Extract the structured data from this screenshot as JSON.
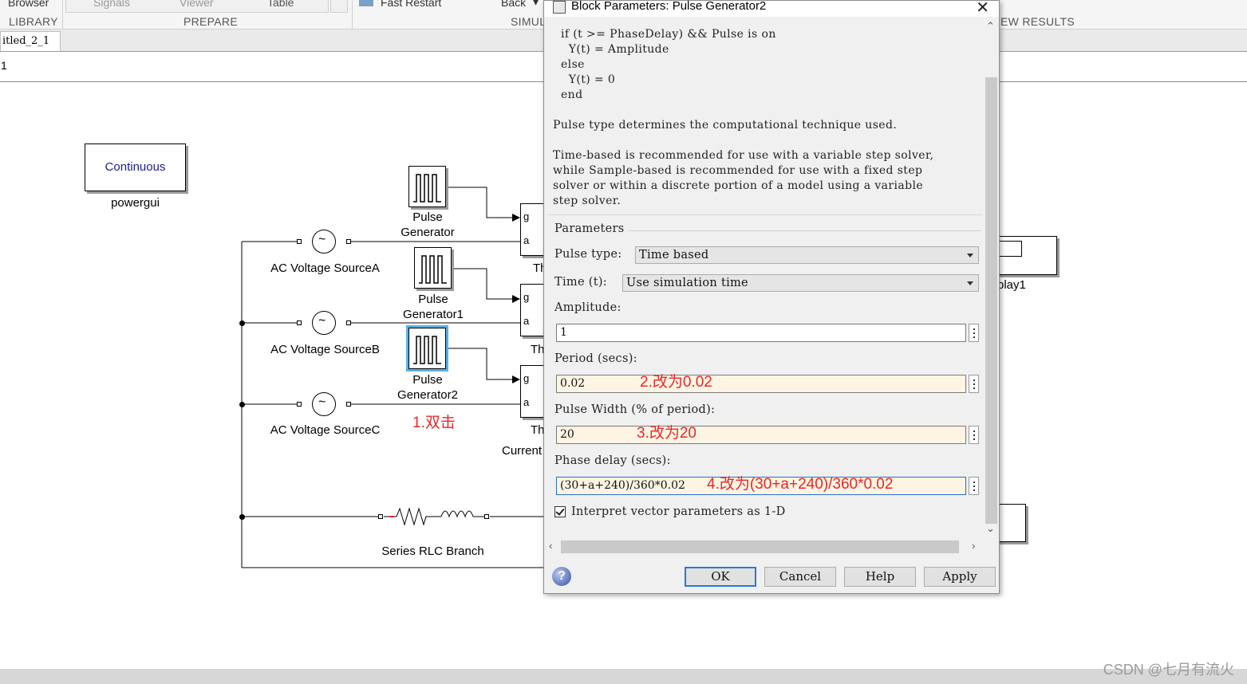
{
  "toolstrip": {
    "items": [
      "Browser",
      "Signals",
      "Viewer",
      "Table",
      "Fast Restart",
      "Back"
    ],
    "sections": [
      "LIBRARY",
      "PREPARE",
      "SIMUL",
      "EW RESULTS"
    ]
  },
  "tabs": {
    "model": "itled_2_1"
  },
  "address": {
    "path": "1"
  },
  "diagram": {
    "powergui": {
      "block_text": "Continuous",
      "label": "powergui"
    },
    "pulse_generators": [
      {
        "label_line1": "Pulse",
        "label_line2": "Generator"
      },
      {
        "label_line1": "Pulse",
        "label_line2": "Generator1"
      },
      {
        "label_line1": "Pulse",
        "label_line2": "Generator2"
      }
    ],
    "ac_sources": [
      "AC Voltage SourceA",
      "AC Voltage SourceB",
      "AC Voltage SourceC"
    ],
    "thyristor": {
      "port_g": "g",
      "port_a": "a",
      "label_prefix": "Th"
    },
    "current_label": "Current",
    "rlc_label": "Series RLC Branch",
    "display_label": "play1",
    "annotation_double_click": "1.双击"
  },
  "dialog": {
    "title": "Block Parameters: Pulse Generator2",
    "description_lines": [
      "if (t >= PhaseDelay) && Pulse is on",
      "  Y(t) = Amplitude",
      "else",
      "  Y(t) = 0",
      "end",
      "Pulse type determines the computational technique used.",
      "Time-based is recommended for use with a variable step solver,",
      "while Sample-based is recommended for use with a fixed step",
      "solver or within a discrete portion of a model using a variable",
      "step solver."
    ],
    "parameters_heading": "Parameters",
    "pulse_type": {
      "label": "Pulse type:",
      "value": "Time based"
    },
    "time": {
      "label": "Time (t):",
      "value": "Use simulation time"
    },
    "amplitude": {
      "label": "Amplitude:",
      "value": "1"
    },
    "period": {
      "label": "Period (secs):",
      "value": "0.02",
      "note": "2.改为0.02"
    },
    "pulse_width": {
      "label": "Pulse Width (% of period):",
      "value": "20",
      "note": "3.改为20"
    },
    "phase_delay": {
      "label": "Phase delay (secs):",
      "value": "(30+a+240)/360*0.02",
      "note": "4.改为(30+a+240)/360*0.02"
    },
    "interpret_checkbox": {
      "label": "Interpret vector parameters as 1-D",
      "checked": true
    },
    "buttons": {
      "ok": "OK",
      "cancel": "Cancel",
      "help": "Help",
      "apply": "Apply"
    }
  },
  "watermark": "CSDN @七月有流火",
  "colors": {
    "annotation_red": "#e8262a",
    "selection_blue": "#5aaee6",
    "changed_field": "#fef4e3"
  }
}
